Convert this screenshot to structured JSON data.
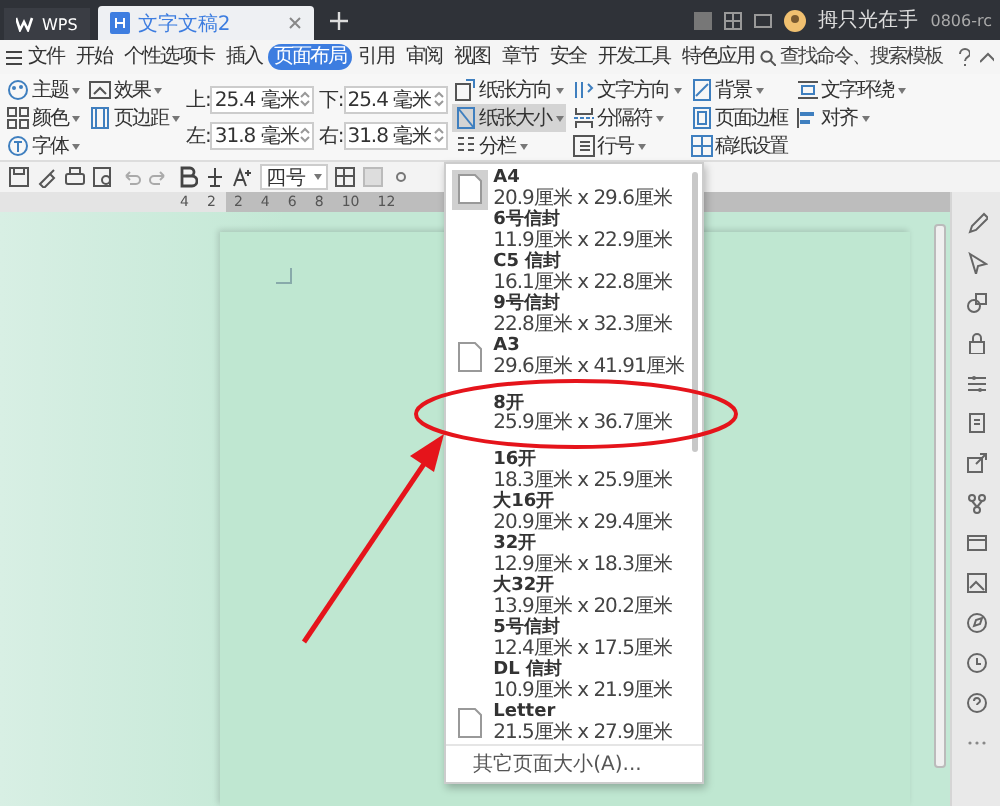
{
  "title_bar": {
    "app_tab": "WPS",
    "doc_tab": "文字文稿2",
    "user": "拇只光在手",
    "account": "0806-rc"
  },
  "menu": {
    "file": "文件",
    "tabs": [
      {
        "label": "开始",
        "selected": false
      },
      {
        "label": "个性选项卡",
        "selected": false
      },
      {
        "label": "插入",
        "selected": false
      },
      {
        "label": "页面布局",
        "selected": true
      },
      {
        "label": "引用",
        "selected": false
      },
      {
        "label": "审阅",
        "selected": false
      },
      {
        "label": "视图",
        "selected": false
      },
      {
        "label": "章节",
        "selected": false
      },
      {
        "label": "安全",
        "selected": false
      },
      {
        "label": "开发工具",
        "selected": false
      },
      {
        "label": "特色应用",
        "selected": false
      }
    ],
    "search": {
      "placeholder": "查找命令、搜索模板"
    }
  },
  "ribbon": {
    "left_columns": [
      [
        {
          "kind": "theme",
          "label": "主题",
          "dropdown": true,
          "pressed": false
        },
        {
          "kind": "color",
          "label": "颜色",
          "dropdown": true,
          "pressed": false
        },
        {
          "kind": "font",
          "label": "字体",
          "dropdown": true,
          "pressed": false
        }
      ],
      [
        {
          "kind": "effect",
          "label": "效果",
          "dropdown": true,
          "pressed": false
        },
        {
          "kind": "margins",
          "label": "页边距",
          "dropdown": true,
          "pressed": false
        }
      ]
    ],
    "margins": [
      {
        "label": "上:",
        "value": "25.4 毫米"
      },
      {
        "label": "下:",
        "value": "25.4 毫米"
      },
      {
        "label": "左:",
        "value": "31.8 毫米"
      },
      {
        "label": "右:",
        "value": "31.8 毫米"
      }
    ],
    "right_columns": [
      [
        {
          "kind": "orientation",
          "label": "纸张方向",
          "dropdown": true,
          "pressed": false
        },
        {
          "kind": "size",
          "label": "纸张大小",
          "dropdown": true,
          "pressed": true
        },
        {
          "kind": "columns",
          "label": "分栏",
          "dropdown": true,
          "pressed": false
        }
      ],
      [
        {
          "kind": "textdir",
          "label": "文字方向",
          "dropdown": true,
          "pressed": false
        },
        {
          "kind": "breaks",
          "label": "分隔符",
          "dropdown": true,
          "pressed": false
        },
        {
          "kind": "linenum",
          "label": "行号",
          "dropdown": true,
          "pressed": false
        }
      ],
      [
        {
          "kind": "background",
          "label": "背景",
          "dropdown": true,
          "pressed": false
        },
        {
          "kind": "border",
          "label": "页面边框",
          "dropdown": false,
          "pressed": false
        },
        {
          "kind": "manuscript",
          "label": "稿纸设置",
          "dropdown": false,
          "pressed": false
        }
      ],
      [
        {
          "kind": "wrap",
          "label": "文字环绕",
          "dropdown": true,
          "pressed": false
        },
        {
          "kind": "align",
          "label": "对齐",
          "dropdown": true,
          "pressed": false
        }
      ]
    ]
  },
  "toolbar": {
    "font_size": "四号"
  },
  "ruler": {
    "ticks": [
      "4",
      "2",
      "2",
      "4",
      "6",
      "8",
      "10",
      "12"
    ]
  },
  "paper_menu": {
    "items": [
      {
        "name": "A4",
        "size": "20.9厘米 x 29.6厘米",
        "icon": true,
        "selected": true,
        "annotated": false
      },
      {
        "name": "6号信封",
        "size": "11.9厘米 x 22.9厘米",
        "icon": false,
        "selected": false,
        "annotated": false
      },
      {
        "name": "C5 信封",
        "size": "16.1厘米 x 22.8厘米",
        "icon": false,
        "selected": false,
        "annotated": false
      },
      {
        "name": "9号信封",
        "size": "22.8厘米 x 32.3厘米",
        "icon": false,
        "selected": false,
        "annotated": false
      },
      {
        "name": "A3",
        "size": "29.6厘米 x 41.91厘米",
        "icon": true,
        "selected": false,
        "annotated": false
      },
      {
        "name": "8开",
        "size": "25.9厘米 x 36.7厘米",
        "icon": false,
        "selected": false,
        "annotated": true
      },
      {
        "name": "16开",
        "size": "18.3厘米 x 25.9厘米",
        "icon": false,
        "selected": false,
        "annotated": false
      },
      {
        "name": "大16开",
        "size": "20.9厘米 x 29.4厘米",
        "icon": false,
        "selected": false,
        "annotated": false
      },
      {
        "name": "32开",
        "size": "12.9厘米 x 18.3厘米",
        "icon": false,
        "selected": false,
        "annotated": false
      },
      {
        "name": "大32开",
        "size": "13.9厘米 x 20.2厘米",
        "icon": false,
        "selected": false,
        "annotated": false
      },
      {
        "name": "5号信封",
        "size": "12.4厘米 x 17.5厘米",
        "icon": false,
        "selected": false,
        "annotated": false
      },
      {
        "name": "DL 信封",
        "size": "10.9厘米 x 21.9厘米",
        "icon": false,
        "selected": false,
        "annotated": false
      },
      {
        "name": "Letter",
        "size": "21.5厘米 x 27.9厘米",
        "icon": true,
        "selected": false,
        "annotated": false
      }
    ],
    "footer": "其它页面大小(A)..."
  }
}
